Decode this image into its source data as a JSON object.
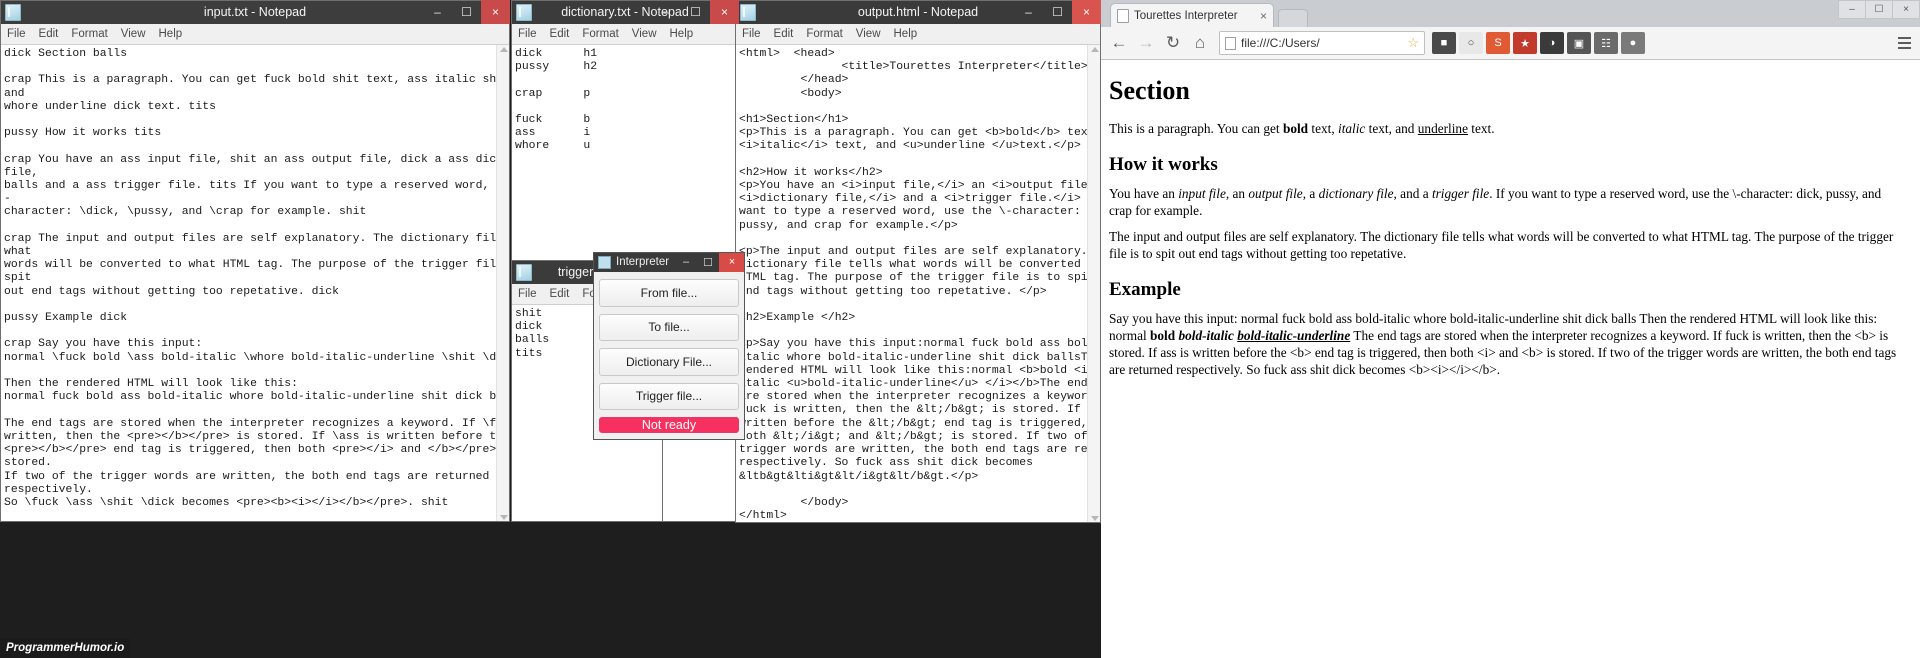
{
  "windows": {
    "input": {
      "title": "input.txt - Notepad",
      "menu": [
        "File",
        "Edit",
        "Format",
        "View",
        "Help"
      ],
      "content": "dick Section balls\n\ncrap This is a paragraph. You can get fuck bold shit text, ass italic shit text,\nand\nwhore underline dick text. tits\n\npussy How it works tits\n\ncrap You have an ass input file, shit an ass output file, dick a ass dictionary\nfile,\nballs and a ass trigger file. tits If you want to type a reserved word, use the \\\n-\ncharacter: \\dick, \\pussy, and \\crap for example. shit\n\ncrap The input and output files are self explanatory. The dictionary file tells\nwhat\nwords will be converted to what HTML tag. The purpose of the trigger file is to\nspit\nout end tags without getting too repetative. dick\n\npussy Example dick\n\ncrap Say you have this input:\nnormal \\fuck bold \\ass bold-italic \\whore bold-italic-underline \\shit \\dick \\balls\n\nThen the rendered HTML will look like this:\nnormal fuck bold ass bold-italic whore bold-italic-underline shit dick balls\n\nThe end tags are stored when the interpreter recognizes a keyword. If \\fuck is\nwritten, then the <pre></b></pre> is stored. If \\ass is written before the\n<pre></b></pre> end tag is triggered, then both <pre></i> and </b></pre> is\nstored.\nIf two of the trigger words are written, the both end tags are returned\nrespectively.\nSo \\fuck \\ass \\shit \\dick becomes <pre><b><i></i></b></pre>. shit"
    },
    "dictionary": {
      "title": "dictionary.txt - Notepad",
      "menu": [
        "File",
        "Edit",
        "Format",
        "View",
        "Help"
      ],
      "content": "dick      h1\npussy     h2\n\ncrap      p\n\nfuck      b\nass       i\nwhore     u"
    },
    "triggers": {
      "title": "triggers.txt",
      "menu": [
        "File",
        "Edit",
        "Format"
      ],
      "content": "shit\ndick\nballs\ntits"
    },
    "output": {
      "title": "output.html - Notepad",
      "menu": [
        "File",
        "Edit",
        "Format",
        "View",
        "Help"
      ],
      "content": "<html>  <head>\n               <title>Tourettes Interpreter</title>\n         </head>\n         <body>\n\n<h1>Section</h1>\n<p>This is a paragraph. You can get <b>bold</b> text,\n<i>italic</i> text, and <u>underline </u>text.</p>\n\n<h2>How it works</h2>\n<p>You have an <i>input file,</i> an <i>output file, </i>a\n<i>dictionary file,</i> and a <i>trigger file.</i> If you\nwant to type a reserved word, use the \\-character: dick,\npussy, and crap for example.</p>\n\n<p>The input and output files are self explanatory. The\ndictionary file tells what words will be converted to what\nHTML tag. The purpose of the trigger file is to spit out\nend tags without getting too repetative. </p>\n\n<h2>Example </h2>\n\n<p>Say you have this input:normal fuck bold ass bold-\nitalic whore bold-italic-underline shit dick ballsThen the\nrendered HTML will look like this:normal <b>bold <i>bold-\nitalic <u>bold-italic-underline</u> </i></b>The end tags\nare stored when the interpreter recognizes a keyword. If\nfuck is written, then the &lt;/b&gt; is stored. If ass is\nwritten before the &lt;/b&gt; end tag is triggered, then\nboth &lt;/i&gt; and &lt;/b&gt; is stored. If two of the\ntrigger words are written, the both end tags are returned\nrespectively. So fuck ass shit dick becomes\n&ltb&gt&lti&gt&lt/i&gt&lt/b&gt.</p>\n\n         </body>\n</html>"
    }
  },
  "interpreter": {
    "title": "Interpreter",
    "buttons": [
      "From file...",
      "To file...",
      "Dictionary File...",
      "Trigger file..."
    ],
    "status_label": "Not ready",
    "status_color": "#f6305f"
  },
  "browser": {
    "tab_title": "Tourettes Interpreter",
    "tab_close": "×",
    "url": "file:///C:/Users/",
    "nav": {
      "back": "←",
      "forward": "→",
      "reload": "↻",
      "home": "⌂"
    },
    "extensions": [
      {
        "name": "adblock-extension-icon",
        "color": "#4a4a4a",
        "glyph": "■"
      },
      {
        "name": "clock-extension-icon",
        "color": "#e8e8e8",
        "glyph": "○"
      },
      {
        "name": "stumbleupon-extension-icon",
        "color": "#e05a34",
        "glyph": "S"
      },
      {
        "name": "lastpass-extension-icon",
        "color": "#c23a2b",
        "glyph": "★"
      },
      {
        "name": "mask-extension-icon",
        "color": "#3a3a3a",
        "glyph": "◑"
      },
      {
        "name": "camera-extension-icon",
        "color": "#555555",
        "glyph": "▣"
      },
      {
        "name": "settings-extension-icon",
        "color": "#6a6a6a",
        "glyph": "☷"
      },
      {
        "name": "globe-extension-icon",
        "color": "#7a7a7a",
        "glyph": "●"
      }
    ],
    "page": {
      "h1": "Section",
      "p1_before": "This is a paragraph. You can get ",
      "p1_bold": "bold",
      "p1_mid1": " text, ",
      "p1_italic": "italic",
      "p1_mid2": " text, and ",
      "p1_underline": "underline",
      "p1_after": " text.",
      "h2_works": "How it works",
      "p2_a": "You have an ",
      "p2_i1": "input file",
      "p2_b": ", an ",
      "p2_i2": "output file",
      "p2_c": ", a ",
      "p2_i3": "dictionary file",
      "p2_d": ", and a ",
      "p2_i4": "trigger file",
      "p2_e": ". If you want to type a reserved word, use the \\-character: dick, pussy, and crap for example.",
      "p3": "The input and output files are self explanatory. The dictionary file tells what words will be converted to what HTML tag. The purpose of the trigger file is to spit out end tags without getting too repetative.",
      "h2_example": "Example",
      "p4_a": "Say you have this input: normal fuck bold ass bold-italic whore bold-italic-underline shit dick balls Then the rendered HTML will look like this: normal ",
      "p4_bold": "bold ",
      "p4_bolditalic": "bold-italic ",
      "p4_bolditalicunderline": "bold-italic-underline",
      "p4_b": " The end tags are stored when the interpreter recognizes a keyword. If fuck is written, then the <b> is stored. If ass is written before the <b> end tag is triggered, then both <i> and <b> is stored. If two of the trigger words are written, the both end tags are returned respectively. So fuck ass shit dick becomes <b><i></i></b>."
    }
  },
  "watermark": "ProgrammerHumor.io",
  "window_controls": {
    "minimize": "–",
    "maximize": "☐",
    "close": "×"
  }
}
